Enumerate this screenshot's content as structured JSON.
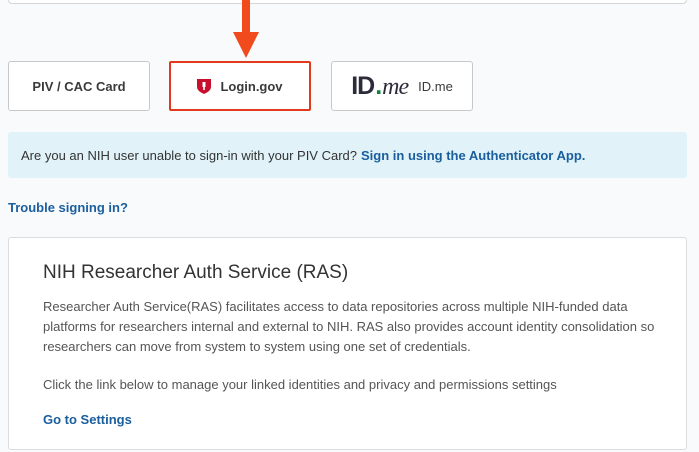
{
  "buttons": {
    "piv_label": "PIV / CAC Card",
    "login_label": "Login.gov",
    "idme_logo_id": "ID",
    "idme_logo_me": "me",
    "idme_label": "ID.me"
  },
  "alert": {
    "text": "Are you an NIH user unable to sign-in with your PIV Card?",
    "link": "Sign in using the Authenticator App."
  },
  "trouble_link": "Trouble signing in?",
  "ras": {
    "title": "NIH Researcher Auth Service (RAS)",
    "description": "Researcher Auth Service(RAS) facilitates access to data repositories across multiple NIH-funded data platforms for researchers internal and external to NIH. RAS also provides account identity consolidation so researchers can move from system to system using one set of credentials.",
    "note": "Click the link below to manage your linked identities and privacy and permissions settings",
    "settings_link": "Go to Settings"
  },
  "colors": {
    "highlight": "#e23a1c",
    "link": "#1a5e9e",
    "alert_bg": "#e1f3f8",
    "idme_green": "#08833d"
  },
  "icons": [
    "down-arrow-icon",
    "login-gov-shield-icon",
    "idme-logo"
  ]
}
